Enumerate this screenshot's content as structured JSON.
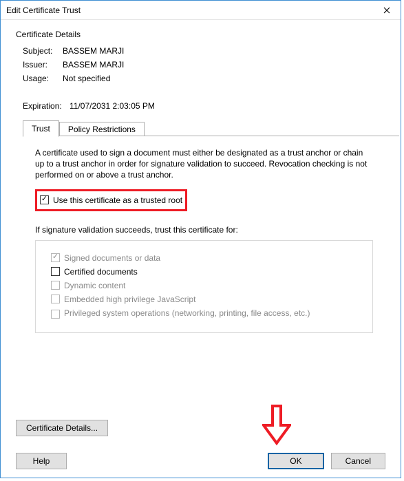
{
  "window": {
    "title": "Edit Certificate Trust"
  },
  "section": {
    "title": "Certificate Details"
  },
  "fields": {
    "subject_label": "Subject:",
    "subject_value": "BASSEM MARJI",
    "issuer_label": "Issuer:",
    "issuer_value": "BASSEM MARJI",
    "usage_label": "Usage:",
    "usage_value": "Not specified"
  },
  "expiration": {
    "label": "Expiration:",
    "value": "11/07/2031 2:03:05 PM"
  },
  "tabs": {
    "trust": "Trust",
    "policy": "Policy Restrictions"
  },
  "trust_tab": {
    "description": "A certificate used to sign a document must either be designated as a trust anchor or chain up to a trust anchor in order for signature validation to succeed.  Revocation checking is not performed on or above a trust anchor.",
    "trusted_root": "Use this certificate as a trusted root",
    "if_success": "If signature validation succeeds, trust this certificate for:",
    "signed_docs": "Signed documents or data",
    "certified_docs": "Certified documents",
    "dynamic": "Dynamic content",
    "embedded_js": "Embedded high privilege JavaScript",
    "priv_ops": "Privileged system operations (networking, printing, file access, etc.)"
  },
  "buttons": {
    "details": "Certificate Details...",
    "help": "Help",
    "ok": "OK",
    "cancel": "Cancel"
  }
}
